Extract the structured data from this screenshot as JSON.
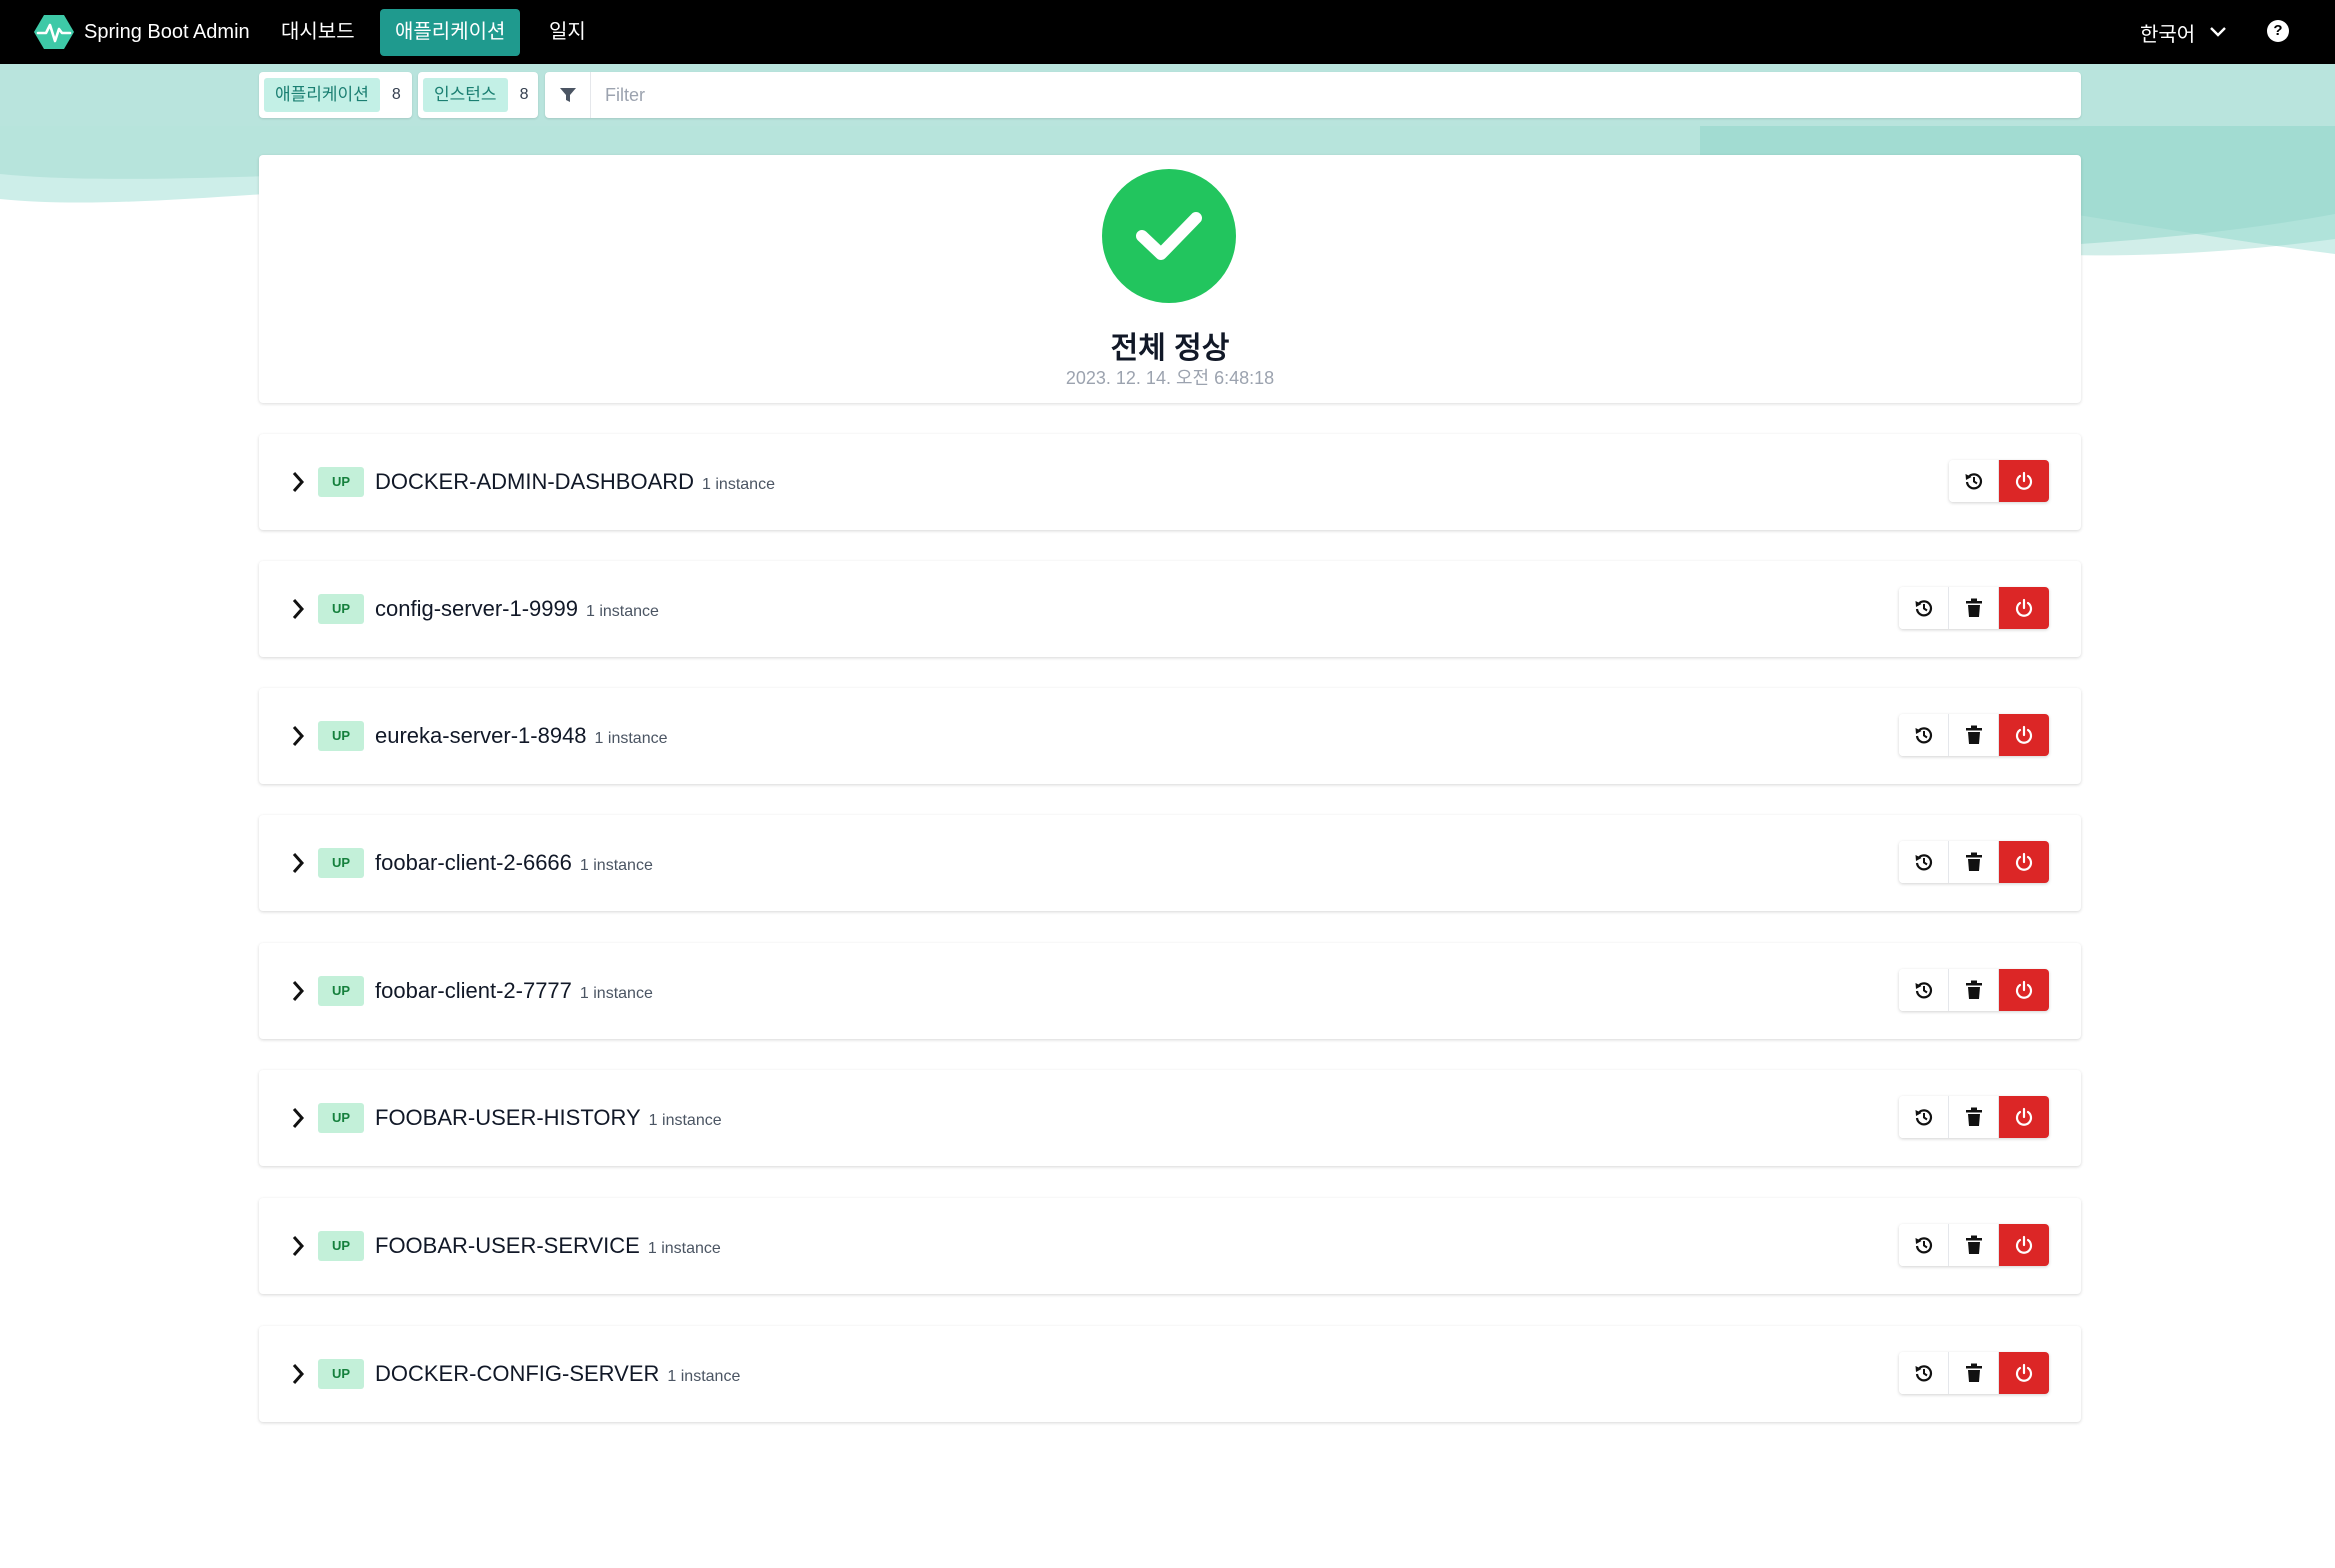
{
  "navbar": {
    "brand": "Spring Boot Admin",
    "links": [
      {
        "label": "대시보드",
        "active": false
      },
      {
        "label": "애플리케이션",
        "active": true
      },
      {
        "label": "일지",
        "active": false
      }
    ],
    "language": "한국어",
    "help_icon": "question-circle-icon"
  },
  "filter": {
    "applications_label": "애플리케이션",
    "applications_count": "8",
    "instances_label": "인스턴스",
    "instances_count": "8",
    "placeholder": "Filter",
    "value": ""
  },
  "health": {
    "title": "전체 정상",
    "timestamp": "2023. 12. 14. 오전 6:48:18",
    "color": "#22c55e"
  },
  "applications": [
    {
      "status": "UP",
      "name": "DOCKER-ADMIN-DASHBOARD",
      "instances": "1 instance",
      "actions": [
        "restart",
        "shutdown"
      ]
    },
    {
      "status": "UP",
      "name": "config-server-1-9999",
      "instances": "1 instance",
      "actions": [
        "restart",
        "delete",
        "shutdown"
      ]
    },
    {
      "status": "UP",
      "name": "eureka-server-1-8948",
      "instances": "1 instance",
      "actions": [
        "restart",
        "delete",
        "shutdown"
      ]
    },
    {
      "status": "UP",
      "name": "foobar-client-2-6666",
      "instances": "1 instance",
      "actions": [
        "restart",
        "delete",
        "shutdown"
      ]
    },
    {
      "status": "UP",
      "name": "foobar-client-2-7777",
      "instances": "1 instance",
      "actions": [
        "restart",
        "delete",
        "shutdown"
      ]
    },
    {
      "status": "UP",
      "name": "FOOBAR-USER-HISTORY",
      "instances": "1 instance",
      "actions": [
        "restart",
        "delete",
        "shutdown"
      ]
    },
    {
      "status": "UP",
      "name": "FOOBAR-USER-SERVICE",
      "instances": "1 instance",
      "actions": [
        "restart",
        "delete",
        "shutdown"
      ]
    },
    {
      "status": "UP",
      "name": "DOCKER-CONFIG-SERVER",
      "instances": "1 instance",
      "actions": [
        "restart",
        "delete",
        "shutdown"
      ]
    }
  ],
  "colors": {
    "navbar_bg": "#000000",
    "accent": "#1f9a8e",
    "status_up_bg": "#c3f0d9",
    "status_up_text": "#15803d",
    "danger": "#dc2626"
  }
}
